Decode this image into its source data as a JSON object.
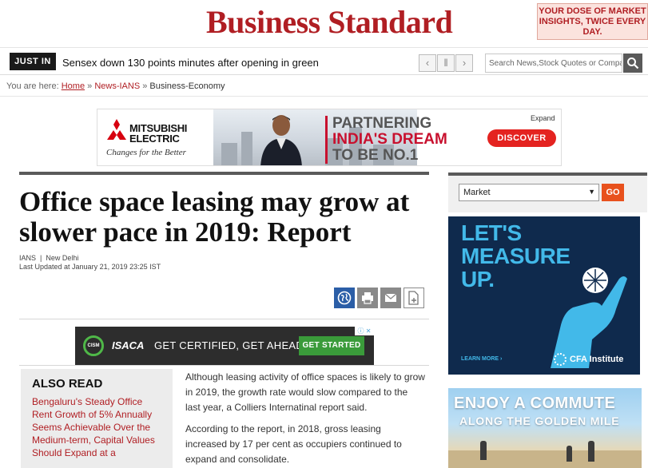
{
  "header": {
    "logo": "Business Standard",
    "promo": "YOUR DOSE OF MARKET INSIGHTS, TWICE EVERY DAY."
  },
  "ticker": {
    "label": "JUST IN",
    "headline": "Sensex down 130 points minutes after opening in green",
    "prev": "‹",
    "pause": "‖",
    "next": "›",
    "search_placeholder": "Search News,Stock Quotes or Companies"
  },
  "breadcrumb": {
    "prefix": "You are here:",
    "home": "Home",
    "sep": "»",
    "section": "News-IANS",
    "current": "Business-Economy"
  },
  "ad_top": {
    "brand_line1": "MITSUBISHI",
    "brand_line2": "ELECTRIC",
    "tagline": "Changes for the Better",
    "slogan_line1": "PARTNERING",
    "slogan_line2": "INDIA'S DREAM",
    "slogan_line3": "TO BE NO.1",
    "expand": "Expand",
    "cta": "DISCOVER"
  },
  "article": {
    "title": "Office space leasing may grow at slower pace in 2019: Report",
    "source": "IANS",
    "location": "New Delhi",
    "updated": "Last Updated at January 21, 2019 23:25 IST",
    "paragraphs": [
      "Although leasing activity of office spaces is likely to grow in 2019, the growth rate would slow compared to the last year, a Colliers Internatinal report said.",
      "According to the report, in 2018, gross leasing increased by 17 per cent as occupiers continued to expand and consolidate."
    ]
  },
  "ad_isaca": {
    "badge": "CISM",
    "brand": "ISACA",
    "text": "GET CERTIFIED, GET AHEAD",
    "cta": "GET STARTED",
    "adchoices": "ⓘ ✕"
  },
  "also_read": {
    "title": "ALSO READ",
    "item": "Bengaluru's Steady Office Rent Growth of 5% Annually Seems Achievable Over the Medium-term, Capital Values Should Expand at a"
  },
  "sidebar": {
    "market_select": "Market",
    "go": "GO",
    "cfa_title_1": "LET'S",
    "cfa_title_2": "MEASURE",
    "cfa_title_3": "UP.",
    "cfa_learn": "LEARN MORE ›",
    "cfa_brand": "CFA Institute",
    "commute_t1": "ENJOY A COMMUTE",
    "commute_t2": "ALONG THE GOLDEN MILE"
  }
}
